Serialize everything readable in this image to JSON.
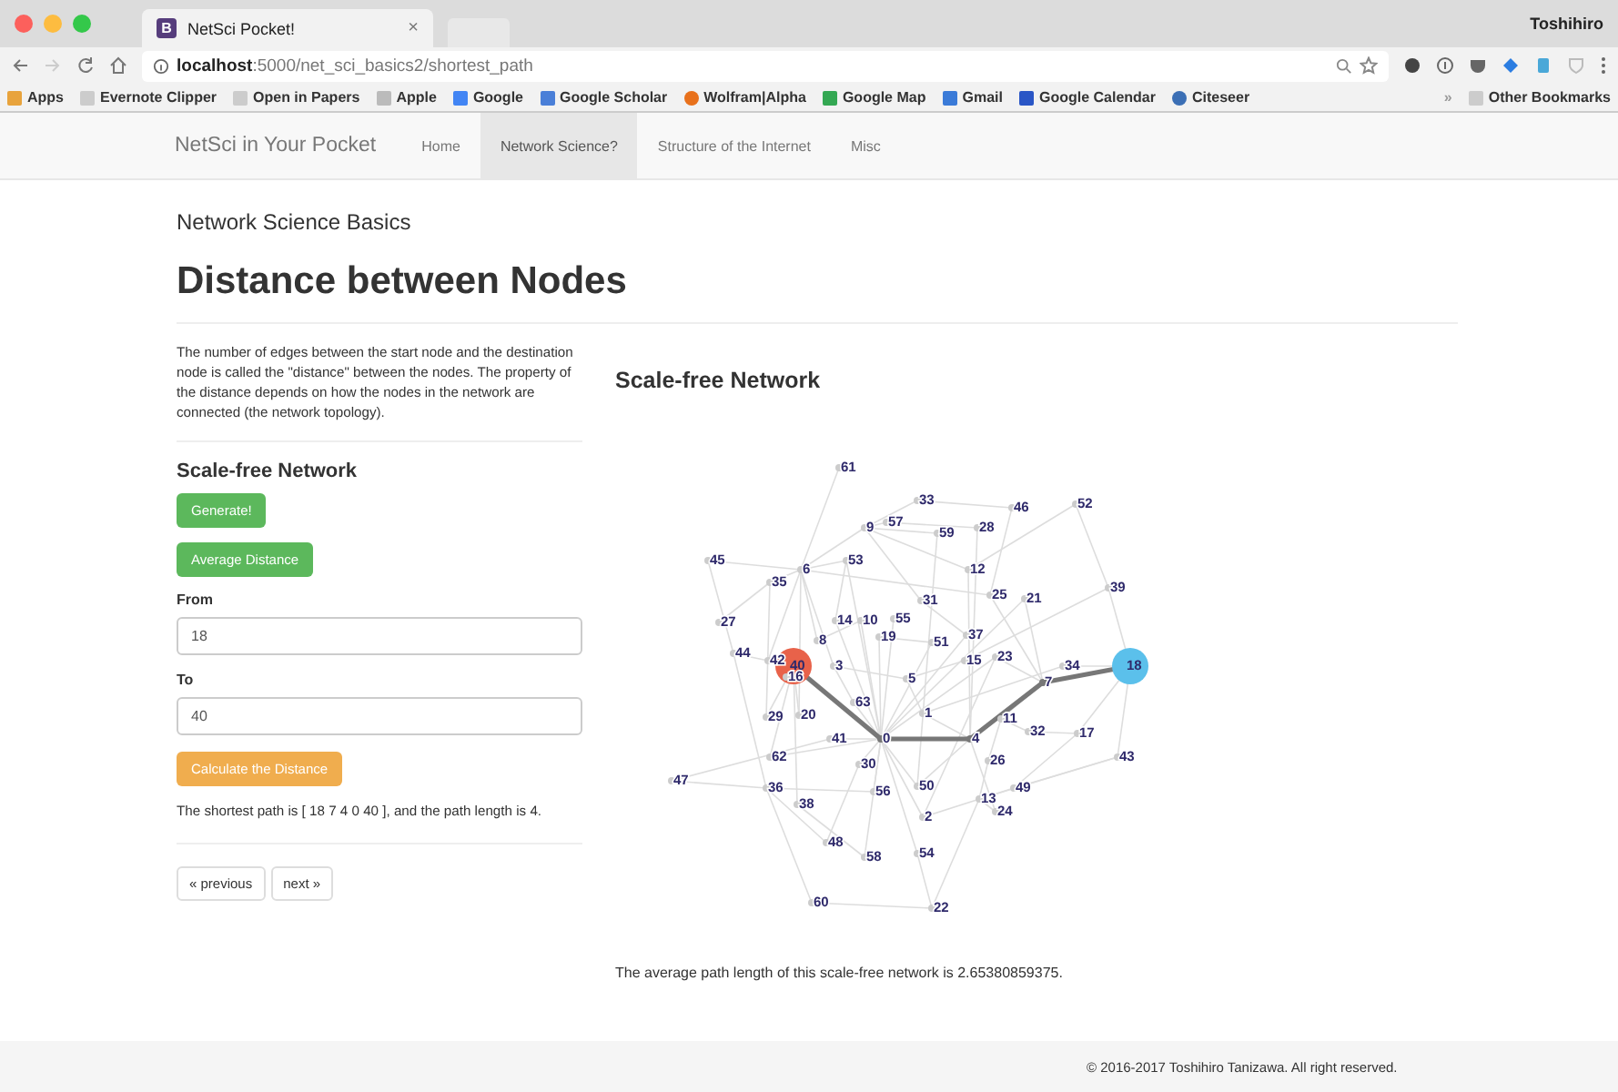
{
  "browser": {
    "tab": {
      "title": "NetSci Pocket!",
      "favicon": "B",
      "close": "×"
    },
    "profile": "Toshihiro",
    "address": "**localhost**:5000/net_sci_basics2/shortest_path",
    "bookmarks": [
      {
        "label": "Apps",
        "kind": "apps"
      },
      {
        "label": "Evernote Clipper",
        "kind": "page"
      },
      {
        "label": "Open in Papers",
        "kind": "page"
      },
      {
        "label": "Apple",
        "kind": "folder"
      },
      {
        "label": "Google",
        "kind": "google"
      },
      {
        "label": "Google Scholar",
        "kind": "scholar"
      },
      {
        "label": "Wolfram|Alpha",
        "kind": "wolfram"
      },
      {
        "label": "Google Map",
        "kind": "map"
      },
      {
        "label": "Gmail",
        "kind": "mail"
      },
      {
        "label": "Google Calendar",
        "kind": "calendar"
      },
      {
        "label": "Citeseer",
        "kind": "citeseer"
      }
    ],
    "overflow": "»",
    "other_bookmarks": "Other Bookmarks"
  },
  "navbar": {
    "brand": "NetSci in Your Pocket",
    "items": [
      {
        "label": "Home",
        "selected": false
      },
      {
        "label": "Network Science?",
        "selected": true
      },
      {
        "label": "Structure of the Internet",
        "selected": false
      },
      {
        "label": "Misc",
        "selected": false
      }
    ]
  },
  "page": {
    "subtitle": "Network Science Basics",
    "title": "Distance between Nodes"
  },
  "sidebar": {
    "intro": "The number of edges between the start node and the destination node is called the \"distance\" between the nodes. The property of the distance depends on how the nodes in the network are connected (the network topology).",
    "heading": "Scale-free Network",
    "generate": "Generate!",
    "average": "Average Distance",
    "from": {
      "label": "From",
      "value": "18"
    },
    "to": {
      "label": "To",
      "value": "40"
    },
    "calculate": "Calculate the Distance",
    "result": "The shortest path is [ 18 7 4 0 40 ], and the path length is 4.",
    "pager": [
      "« previous",
      "next »"
    ]
  },
  "main": {
    "heading": "Scale-free Network",
    "average_text": "The average path length of this scale-free network is 2.65380859375.",
    "nodes": [
      {
        "label": "61",
        "kind": "node",
        "on_path": false
      },
      {
        "label": "33",
        "kind": "node",
        "on_path": false
      },
      {
        "label": "46",
        "kind": "node",
        "on_path": false
      },
      {
        "label": "52",
        "kind": "node",
        "on_path": false
      },
      {
        "label": "9",
        "kind": "node",
        "on_path": false
      },
      {
        "label": "57",
        "kind": "node",
        "on_path": false
      },
      {
        "label": "59",
        "kind": "node",
        "on_path": false
      },
      {
        "label": "28",
        "kind": "node",
        "on_path": false
      },
      {
        "label": "45",
        "kind": "node",
        "on_path": false
      },
      {
        "label": "6",
        "kind": "node",
        "on_path": false
      },
      {
        "label": "53",
        "kind": "node",
        "on_path": false
      },
      {
        "label": "12",
        "kind": "node",
        "on_path": false
      },
      {
        "label": "35",
        "kind": "node",
        "on_path": false
      },
      {
        "label": "31",
        "kind": "node",
        "on_path": false
      },
      {
        "label": "25",
        "kind": "node",
        "on_path": false
      },
      {
        "label": "21",
        "kind": "node",
        "on_path": false
      },
      {
        "label": "39",
        "kind": "node",
        "on_path": false
      },
      {
        "label": "27",
        "kind": "node",
        "on_path": false
      },
      {
        "label": "14",
        "kind": "node",
        "on_path": false
      },
      {
        "label": "10",
        "kind": "node",
        "on_path": false
      },
      {
        "label": "55",
        "kind": "node",
        "on_path": false
      },
      {
        "label": "8",
        "kind": "node",
        "on_path": false
      },
      {
        "label": "19",
        "kind": "node",
        "on_path": false
      },
      {
        "label": "51",
        "kind": "node",
        "on_path": false
      },
      {
        "label": "37",
        "kind": "node",
        "on_path": false
      },
      {
        "label": "44",
        "kind": "node",
        "on_path": false
      },
      {
        "label": "42",
        "kind": "node",
        "on_path": false
      },
      {
        "label": "40",
        "kind": "target",
        "on_path": true
      },
      {
        "label": "3",
        "kind": "node",
        "on_path": false
      },
      {
        "label": "15",
        "kind": "node",
        "on_path": false
      },
      {
        "label": "23",
        "kind": "node",
        "on_path": false
      },
      {
        "label": "34",
        "kind": "node",
        "on_path": false
      },
      {
        "label": "18",
        "kind": "source",
        "on_path": true
      },
      {
        "label": "16",
        "kind": "node",
        "on_path": false
      },
      {
        "label": "5",
        "kind": "node",
        "on_path": false
      },
      {
        "label": "7",
        "kind": "node",
        "on_path": true
      },
      {
        "label": "63",
        "kind": "node",
        "on_path": false
      },
      {
        "label": "29",
        "kind": "node",
        "on_path": false
      },
      {
        "label": "20",
        "kind": "node",
        "on_path": false
      },
      {
        "label": "1",
        "kind": "node",
        "on_path": false
      },
      {
        "label": "11",
        "kind": "node",
        "on_path": false
      },
      {
        "label": "41",
        "kind": "node",
        "on_path": false
      },
      {
        "label": "0",
        "kind": "node",
        "on_path": true
      },
      {
        "label": "4",
        "kind": "node",
        "on_path": true
      },
      {
        "label": "32",
        "kind": "node",
        "on_path": false
      },
      {
        "label": "17",
        "kind": "node",
        "on_path": false
      },
      {
        "label": "62",
        "kind": "node",
        "on_path": false
      },
      {
        "label": "30",
        "kind": "node",
        "on_path": false
      },
      {
        "label": "26",
        "kind": "node",
        "on_path": false
      },
      {
        "label": "43",
        "kind": "node",
        "on_path": false
      },
      {
        "label": "47",
        "kind": "node",
        "on_path": false
      },
      {
        "label": "36",
        "kind": "node",
        "on_path": false
      },
      {
        "label": "56",
        "kind": "node",
        "on_path": false
      },
      {
        "label": "50",
        "kind": "node",
        "on_path": false
      },
      {
        "label": "49",
        "kind": "node",
        "on_path": false
      },
      {
        "label": "38",
        "kind": "node",
        "on_path": false
      },
      {
        "label": "2",
        "kind": "node",
        "on_path": false
      },
      {
        "label": "13",
        "kind": "node",
        "on_path": false
      },
      {
        "label": "24",
        "kind": "node",
        "on_path": false
      },
      {
        "label": "48",
        "kind": "node",
        "on_path": false
      },
      {
        "label": "58",
        "kind": "node",
        "on_path": false
      },
      {
        "label": "54",
        "kind": "node",
        "on_path": false
      },
      {
        "label": "60",
        "kind": "node",
        "on_path": false
      },
      {
        "label": "22",
        "kind": "node",
        "on_path": false
      }
    ]
  },
  "footer": "© 2016-2017 Toshihiro Tanizawa. All right reserved."
}
